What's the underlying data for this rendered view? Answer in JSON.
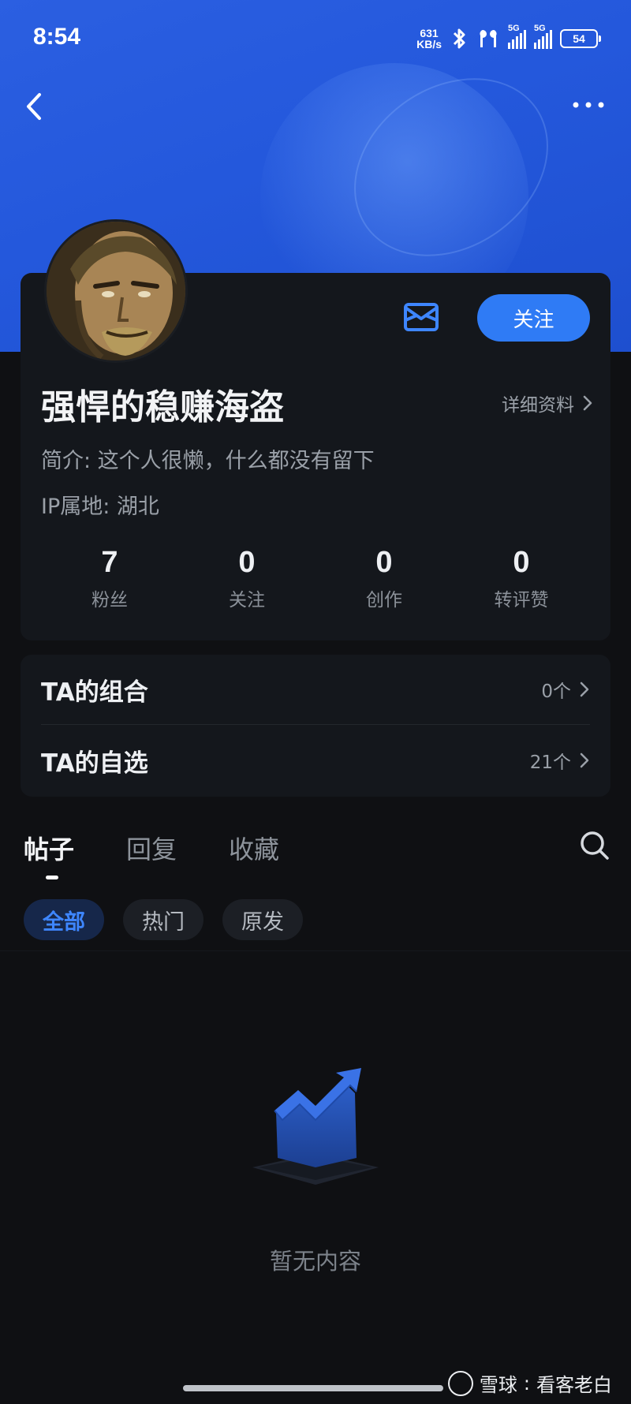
{
  "status_bar": {
    "time": "8:54",
    "net_speed_value": "631",
    "net_speed_unit": "KB/s",
    "signal1_label": "5G",
    "signal2_label": "5G",
    "battery": "54"
  },
  "profile": {
    "username": "强悍的稳赚海盗",
    "detail_link": "详细资料",
    "bio": "简介: 这个人很懒，什么都没有留下",
    "ip": "IP属地: 湖北",
    "follow_label": "关注",
    "stats": [
      {
        "num": "7",
        "label": "粉丝"
      },
      {
        "num": "0",
        "label": "关注"
      },
      {
        "num": "0",
        "label": "创作"
      },
      {
        "num": "0",
        "label": "转评赞"
      }
    ]
  },
  "links": [
    {
      "title": "TA的组合",
      "value": "0个"
    },
    {
      "title": "TA的自选",
      "value": "21个"
    }
  ],
  "tabs": [
    "帖子",
    "回复",
    "收藏"
  ],
  "chips": [
    "全部",
    "热门",
    "原发"
  ],
  "empty_text": "暂无内容",
  "watermark": {
    "brand": "雪球",
    "author": "看客老白"
  },
  "colors": {
    "header_blue": "#2458dc",
    "accent_blue": "#2f7bf5",
    "card_bg": "#14171c",
    "page_bg": "#0f1013"
  }
}
